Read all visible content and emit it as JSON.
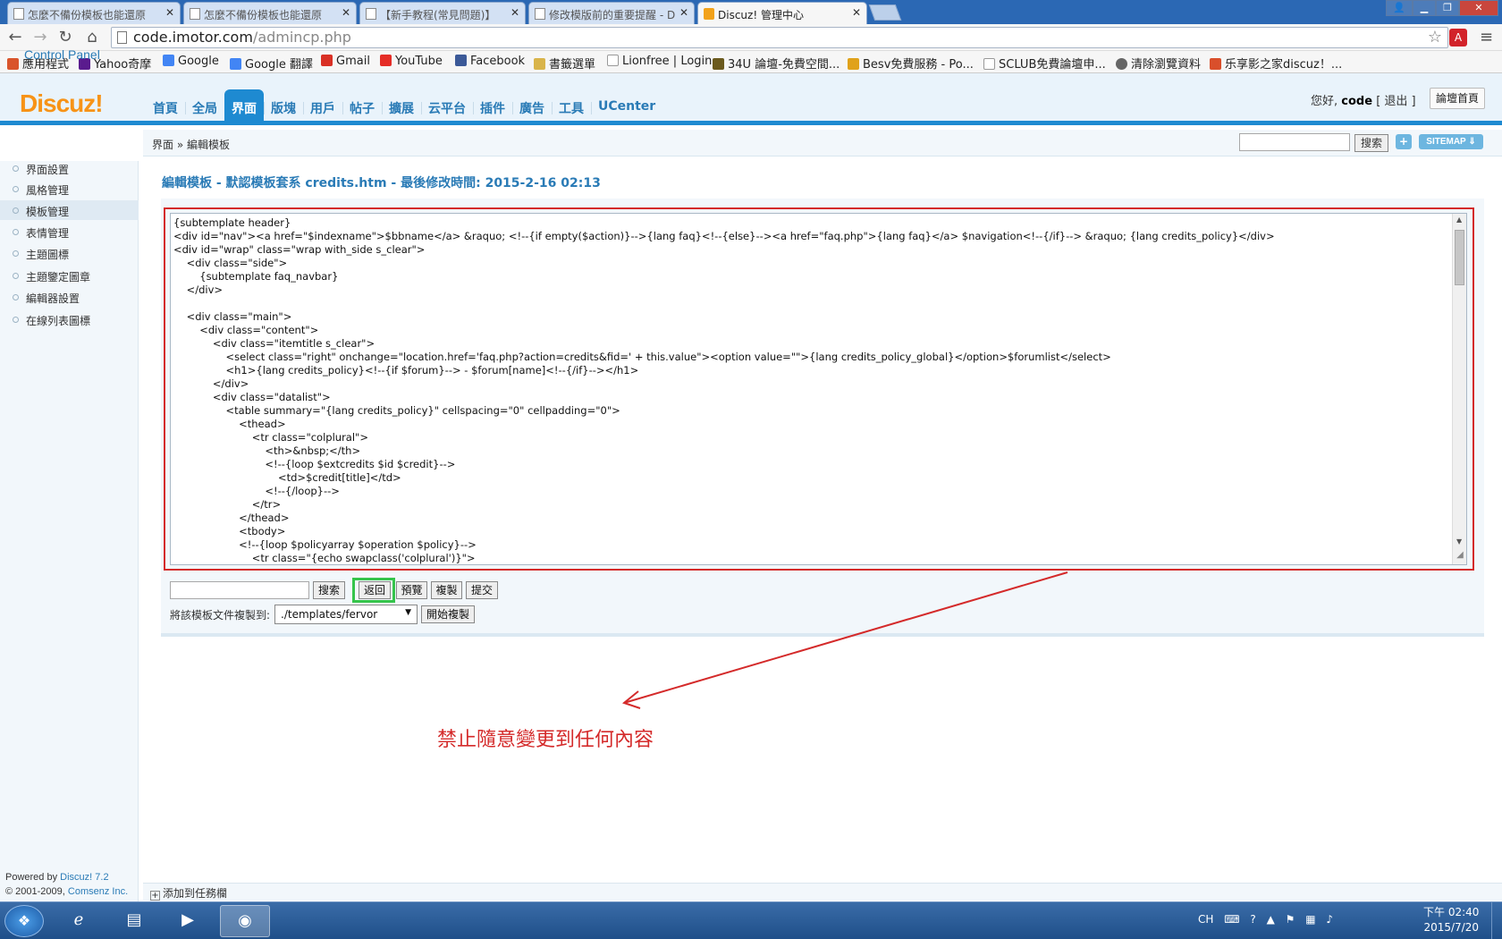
{
  "browser": {
    "tabs": [
      {
        "label": "怎麼不備份模板也能還原"
      },
      {
        "label": "怎麼不備份模板也能還原"
      },
      {
        "label": "【新手教程(常見問題)】"
      },
      {
        "label": "修改模版前的重要提醒 - D"
      },
      {
        "label": "Discuz! 管理中心"
      }
    ],
    "url_host": "code.imotor.com",
    "url_path": "/admincp.php",
    "ext_label": "A",
    "bookmarks": [
      {
        "label": "應用程式",
        "color": "#d9542b"
      },
      {
        "label": "Yahoo奇摩",
        "color": "#5a1b8e"
      },
      {
        "label": "Google",
        "color": "#4285f4"
      },
      {
        "label": "Google 翻譯",
        "color": "#4285f4"
      },
      {
        "label": "Gmail",
        "color": "#d93025"
      },
      {
        "label": "YouTube",
        "color": "#e52d27"
      },
      {
        "label": "Facebook",
        "color": "#3b5998"
      },
      {
        "label": "書籤選單",
        "color": "#d9b44a"
      },
      {
        "label": "Lionfree | Login",
        "color": "#ffffff"
      },
      {
        "label": "34U 論壇-免費空間...",
        "color": "#6b5a1e"
      },
      {
        "label": "Besv免費服務 - Po...",
        "color": "#e0a21b"
      },
      {
        "label": "SCLUB免費論壇申...",
        "color": "#ffffff"
      },
      {
        "label": "清除瀏覽資料",
        "color": "#666666"
      },
      {
        "label": "乐享影之家discuz！...",
        "color": "#d94f2b"
      }
    ]
  },
  "header": {
    "logo": "Discuz!",
    "logo_sub": "Control Panel",
    "nav": [
      "首頁",
      "全局",
      "界面",
      "版塊",
      "用戶",
      "帖子",
      "擴展",
      "云平台",
      "插件",
      "廣告",
      "工具",
      "UCenter"
    ],
    "active_nav": "界面",
    "greeting": "您好,",
    "username": "code",
    "logout": "[ 退出 ]",
    "forum_home": "論壇首頁"
  },
  "crumb": {
    "section": "界面",
    "sep": " » ",
    "page": "編輯模板",
    "search_btn": "搜索",
    "plus": "+",
    "sitemap": "SITEMAP ⇓"
  },
  "sidebar": {
    "items": [
      {
        "label": "界面設置"
      },
      {
        "label": "風格管理"
      },
      {
        "label": "模板管理"
      },
      {
        "label": "表情管理"
      },
      {
        "label": "主題圖標"
      },
      {
        "label": "主題鑒定圖章"
      },
      {
        "label": "編輯器設置"
      },
      {
        "label": "在線列表圖標"
      }
    ],
    "active_index": 2,
    "powered_prefix": "Powered by ",
    "powered_link": "Discuz! 7.2",
    "copyright_prefix": "© 2001-2009, ",
    "copyright_link": "Comsenz Inc."
  },
  "editor": {
    "title": "編輯模板 - 默認模板套系 credits.htm - 最後修改時間: 2015-2-16 02:13",
    "code": "{subtemplate header}\n<div id=\"nav\"><a href=\"$indexname\">$bbname</a> &raquo; <!--{if empty($action)}-->{lang faq}<!--{else}--><a href=\"faq.php\">{lang faq}</a> $navigation<!--{/if}--> &raquo; {lang credits_policy}</div>\n<div id=\"wrap\" class=\"wrap with_side s_clear\">\n\t<div class=\"side\">\n\t\t{subtemplate faq_navbar}\n\t</div>\n\n\t<div class=\"main\">\n\t\t<div class=\"content\">\n\t\t\t<div class=\"itemtitle s_clear\">\n\t\t\t\t<select class=\"right\" onchange=\"location.href='faq.php?action=credits&fid=' + this.value\"><option value=\"\">{lang credits_policy_global}</option>$forumlist</select>\n\t\t\t\t<h1>{lang credits_policy}<!--{if $forum}--> - $forum[name]<!--{/if}--></h1>\n\t\t\t</div>\n\t\t\t<div class=\"datalist\">\n\t\t\t\t<table summary=\"{lang credits_policy}\" cellspacing=\"0\" cellpadding=\"0\">\n\t\t\t\t\t<thead>\n\t\t\t\t\t\t<tr class=\"colplural\">\n\t\t\t\t\t\t\t<th>&nbsp;</th>\n\t\t\t\t\t\t\t<!--{loop $extcredits $id $credit}-->\n\t\t\t\t\t\t\t\t<td>$credit[title]</td>\n\t\t\t\t\t\t\t<!--{/loop}-->\n\t\t\t\t\t\t</tr>\n\t\t\t\t\t</thead>\n\t\t\t\t\t<tbody>\n\t\t\t\t\t<!--{loop $policyarray $operation $policy}-->\n\t\t\t\t\t\t<tr class=\"{echo swapclass('colplural')}\">",
    "search_btn": "搜索",
    "return_btn": "返回",
    "preview_btn": "預覽",
    "copy_btn": "複製",
    "submit_btn": "提交",
    "copy_to_label": "將該模板文件複製到:",
    "copy_to_value": "./templates/fervor",
    "start_copy_btn": "開始複製"
  },
  "annotation": {
    "text": "禁止隨意變更到任何內容",
    "color": "#d42a2a",
    "highlight_color": "#35c44b"
  },
  "statusbar": {
    "add_to_tasks": "添加到任務欄"
  },
  "taskbar": {
    "tray_lang": "CH",
    "time": "下午 02:40",
    "date": "2015/7/20"
  }
}
